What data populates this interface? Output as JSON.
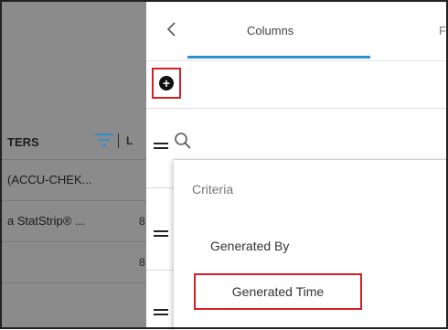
{
  "background_table": {
    "header_label": "TERS",
    "header_right": "L",
    "rows": [
      {
        "text": "(ACCU-CHEK...",
        "num": ""
      },
      {
        "text": "a StatStrip® ...",
        "num": "8"
      },
      {
        "text": "",
        "num": "8"
      },
      {
        "text": "",
        "num": ""
      }
    ]
  },
  "panel": {
    "tabs": {
      "active_label": "Columns",
      "next_label_partial": "F"
    },
    "search": {
      "value": "",
      "placeholder": ""
    },
    "dropdown": {
      "title": "Criteria",
      "items": [
        "Generated By",
        "Generated Time"
      ]
    }
  },
  "colors": {
    "accent": "#2a8fd4",
    "highlight": "#d91f26",
    "dim_overlay": "#8b8b8b"
  },
  "icons": [
    "back-chevron-icon",
    "add-circle-icon",
    "search-icon",
    "drag-handle-icon",
    "filter-icon"
  ]
}
